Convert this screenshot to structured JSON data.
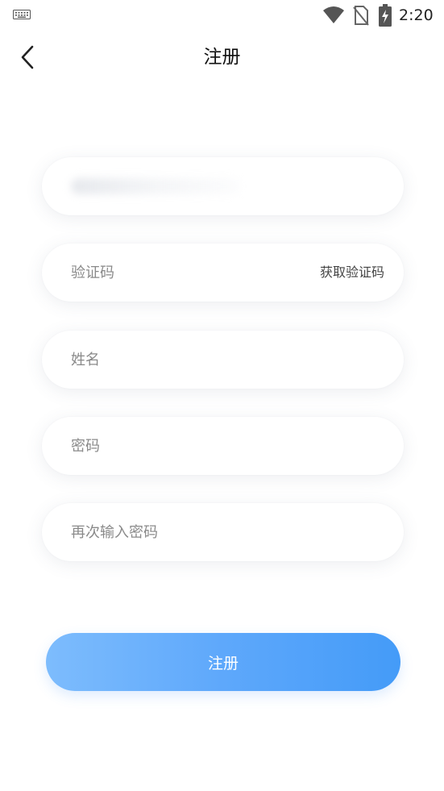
{
  "status_bar": {
    "time": "2:20",
    "icons": [
      "keyboard-icon",
      "wifi-icon",
      "no-sim-icon",
      "battery-charging-icon"
    ]
  },
  "header": {
    "title": "注册",
    "back_icon": "chevron-left-icon"
  },
  "form": {
    "phone": {
      "value": "",
      "placeholder": ""
    },
    "code": {
      "placeholder": "验证码",
      "action_label": "获取验证码"
    },
    "name": {
      "placeholder": "姓名"
    },
    "password": {
      "placeholder": "密码"
    },
    "confirm_password": {
      "placeholder": "再次输入密码"
    }
  },
  "submit": {
    "label": "注册"
  },
  "colors": {
    "accent_start": "#7dbcfd",
    "accent_end": "#449bf8",
    "placeholder": "#8a8a8a",
    "background": "#ffffff"
  }
}
